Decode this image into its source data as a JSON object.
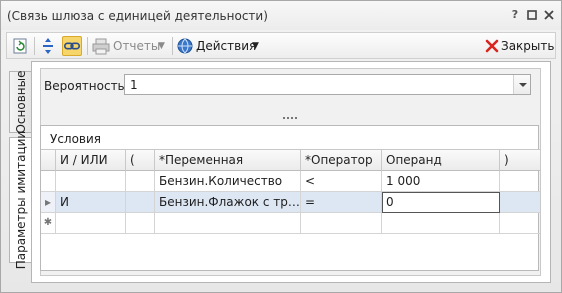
{
  "window": {
    "title": "(Связь шлюза с единицей деятельности)",
    "help_glyph": "?",
    "restore_glyph": "⧠",
    "close_glyph": "✕"
  },
  "toolbar": {
    "reports_label": "Отчеты",
    "actions_label": "Действия",
    "close_label": "Закрыть"
  },
  "tabs": [
    {
      "label": "Основные",
      "active": false
    },
    {
      "label": "Параметры имитации",
      "active": true
    }
  ],
  "probability": {
    "label": "Вероятность:",
    "value": "1"
  },
  "conditions": {
    "caption": "Условия",
    "columns": [
      "И / ИЛИ",
      "(",
      "*Переменная",
      "*Оператор",
      "Операнд",
      ")"
    ],
    "rows": [
      {
        "indicator": "",
        "andor": "",
        "lparen": "",
        "variable": "Бензин.Количество",
        "operator": "<",
        "operand": "1 000",
        "rparen": ""
      },
      {
        "indicator": "▸",
        "andor": "И",
        "lparen": "",
        "variable": "Бензин.Флажок с требо...",
        "operator": "=",
        "operand": "0",
        "rparen": ""
      }
    ],
    "new_row_indicator": "✱"
  },
  "colors": {
    "accent": "#1f5ea8",
    "selection": "#dde7f4",
    "close_red": "#d9251d"
  }
}
